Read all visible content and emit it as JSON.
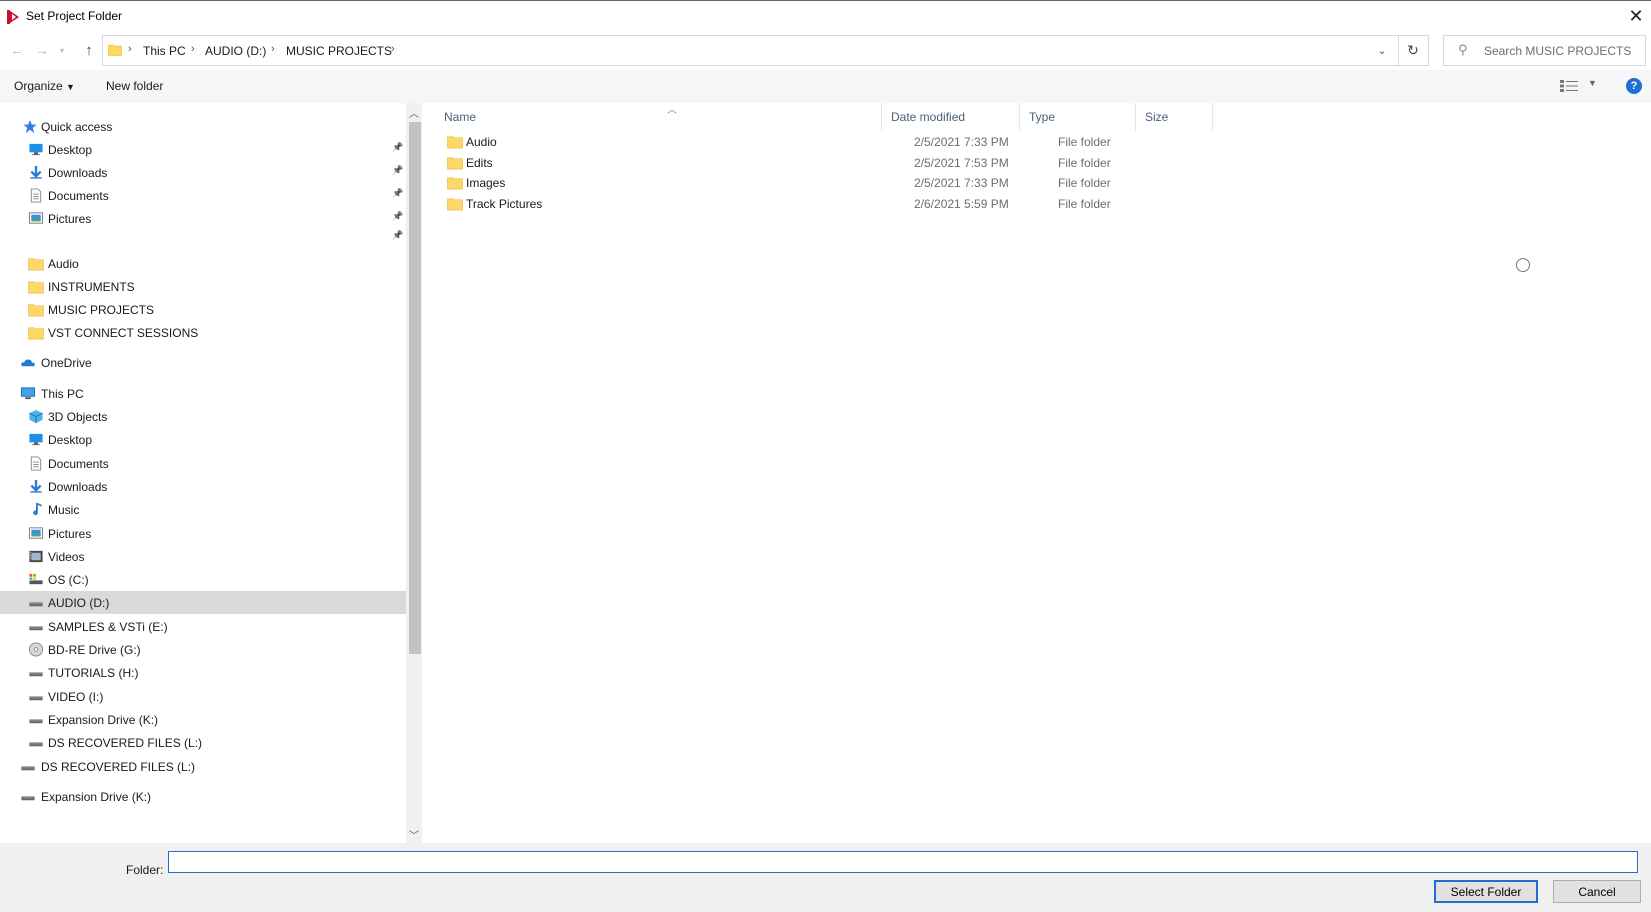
{
  "window": {
    "title": "Set Project Folder"
  },
  "address": {
    "crumbs": [
      "This PC",
      "AUDIO (D:)",
      "MUSIC PROJECTS"
    ],
    "search_placeholder": "Search MUSIC PROJECTS"
  },
  "toolbar": {
    "organize_label": "Organize",
    "new_folder_label": "New folder",
    "help_label": "?"
  },
  "nav": {
    "quick_access": "Quick access",
    "quick_items": [
      {
        "label": "Desktop",
        "icon": "desktop-icon"
      },
      {
        "label": "Downloads",
        "icon": "downloads-icon"
      },
      {
        "label": "Documents",
        "icon": "documents-icon"
      },
      {
        "label": "Pictures",
        "icon": "pictures-icon"
      }
    ],
    "folders": [
      "Audio",
      "INSTRUMENTS",
      "MUSIC PROJECTS",
      "VST CONNECT SESSIONS"
    ],
    "onedrive": "OneDrive",
    "this_pc": "This PC",
    "pc_items": [
      {
        "label": "3D Objects",
        "icon": "3d-objects-icon"
      },
      {
        "label": "Desktop",
        "icon": "desktop-icon"
      },
      {
        "label": "Documents",
        "icon": "documents-icon"
      },
      {
        "label": "Downloads",
        "icon": "downloads-icon"
      },
      {
        "label": "Music",
        "icon": "music-icon"
      },
      {
        "label": "Pictures",
        "icon": "pictures-icon"
      },
      {
        "label": "Videos",
        "icon": "videos-icon"
      },
      {
        "label": "OS (C:)",
        "icon": "os-drive-icon"
      },
      {
        "label": "AUDIO (D:)",
        "icon": "drive-icon"
      },
      {
        "label": "SAMPLES & VSTi (E:)",
        "icon": "drive-icon"
      },
      {
        "label": "BD-RE Drive (G:)",
        "icon": "disc-drive-icon"
      },
      {
        "label": "TUTORIALS (H:)",
        "icon": "drive-icon"
      },
      {
        "label": "VIDEO (I:)",
        "icon": "drive-icon"
      },
      {
        "label": "Expansion Drive (K:)",
        "icon": "drive-icon"
      },
      {
        "label": "DS RECOVERED FILES (L:)",
        "icon": "drive-icon"
      }
    ],
    "roots": [
      "DS RECOVERED FILES (L:)",
      "Expansion Drive (K:)"
    ]
  },
  "columns": {
    "name": "Name",
    "date": "Date modified",
    "type": "Type",
    "size": "Size"
  },
  "files": [
    {
      "name": "Audio",
      "date": "2/5/2021 7:33 PM",
      "type": "File folder"
    },
    {
      "name": "Edits",
      "date": "2/5/2021 7:53 PM",
      "type": "File folder"
    },
    {
      "name": "Images",
      "date": "2/5/2021 7:33 PM",
      "type": "File folder"
    },
    {
      "name": "Track Pictures",
      "date": "2/6/2021 5:59 PM",
      "type": "File folder"
    }
  ],
  "footer": {
    "folder_label": "Folder:",
    "folder_value": "",
    "select_label": "Select Folder",
    "cancel_label": "Cancel"
  },
  "colors": {
    "accent": "#1f6fd1",
    "folder": "#ffd766",
    "selected": "#d9d9d9"
  }
}
